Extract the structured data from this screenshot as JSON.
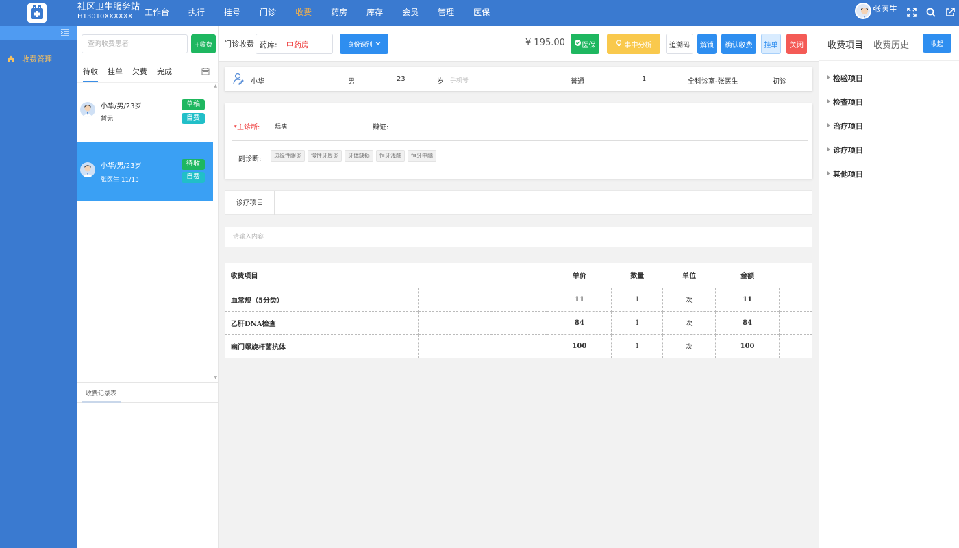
{
  "app": {
    "station_name": "社区卫生服务站",
    "station_code": "H13010XXXXXX",
    "nav": [
      "工作台",
      "执行",
      "挂号",
      "门诊",
      "收费",
      "药房",
      "库存",
      "会员",
      "管理",
      "医保"
    ],
    "active_nav": "收费",
    "user_name": "张医生"
  },
  "sidebar": {
    "menu_label": "收费管理"
  },
  "patient_list": {
    "search_placeholder": "查询收费患者",
    "add_label": "+收费",
    "tabs": [
      "待收",
      "挂单",
      "欠费",
      "完成"
    ],
    "active_tab": "待收",
    "cards": [
      {
        "name": "小华/男/23岁",
        "sub": "暂无",
        "badge1": "草稿",
        "badge2": "自费",
        "selected": false
      },
      {
        "name": "小华/男/23岁",
        "sub": "张医生 11/13",
        "badge1": "待收",
        "badge2": "自费",
        "selected": true
      }
    ],
    "records_title": "收费记录表"
  },
  "toolbar": {
    "label": "门诊收费",
    "pharmacy_label": "药库:",
    "pharmacy_value": "中药房",
    "id_button": "身份识别",
    "price": "¥ 195.00",
    "insurance": "医保",
    "analysis": "事中分析",
    "trace": "追溯码",
    "unlock": "解锁",
    "confirm": "确认收费",
    "hang": "挂单",
    "close": "关闭"
  },
  "patient_info": {
    "name": "小华",
    "gender": "男",
    "age": "23",
    "age_unit": "岁",
    "phone_placeholder": "手机号",
    "visit_type": "普通",
    "count": "1",
    "dept": "全科诊室-张医生",
    "visit": "初诊"
  },
  "diagnosis": {
    "main_label": "*主诊断:",
    "main_value": "龋病",
    "syndrome_label": "辩证:",
    "secondary_label": "副诊断:",
    "secondary_tags": [
      "边缘性龈炎",
      "慢性牙周炎",
      "牙体缺损",
      "恒牙浅龋",
      "恒牙中龋"
    ]
  },
  "items_tab": "诊疗项目",
  "item_input_placeholder": "请输入内容",
  "fee_table": {
    "headers": [
      "收费项目",
      "单价",
      "数量",
      "单位",
      "金额"
    ],
    "rows": [
      {
        "item": "血常规（5分类）",
        "price": "11",
        "qty": "1",
        "unit": "次",
        "amount": "11"
      },
      {
        "item": "乙肝DNA检查",
        "price": "84",
        "qty": "1",
        "unit": "次",
        "amount": "84"
      },
      {
        "item": "幽门螺旋杆菌抗体",
        "price": "100",
        "qty": "1",
        "unit": "次",
        "amount": "100"
      }
    ]
  },
  "right_panel": {
    "tab1": "收费项目",
    "tab2": "收费历史",
    "fold": "收起",
    "categories": [
      "检验项目",
      "检查项目",
      "治疗项目",
      "诊疗项目",
      "其他项目"
    ]
  },
  "colors": {
    "topbar": "#3a7ad0",
    "primary": "#2e8ef0",
    "success": "#1eb760",
    "warning": "#f9c94d",
    "danger": "#f45b56",
    "active_nav": "#f5b04a"
  }
}
